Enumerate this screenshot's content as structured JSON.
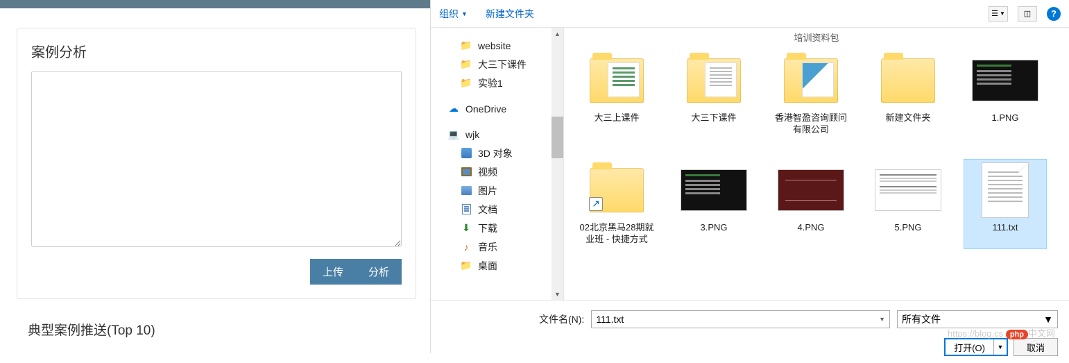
{
  "web": {
    "card_title": "案例分析",
    "upload": "上传",
    "analyze": "分析",
    "top10": "典型案例推送(Top 10)"
  },
  "dialog": {
    "toolbar": {
      "organize": "组织",
      "new_folder": "新建文件夹"
    },
    "tree": {
      "website": "website",
      "dasanxia": "大三下课件",
      "shiyan1": "实验1",
      "onedrive": "OneDrive",
      "pc": "wjk",
      "obj3d": "3D 对象",
      "video": "视频",
      "pics": "图片",
      "docs": "文档",
      "downloads": "下载",
      "music": "音乐",
      "desktop": "桌面"
    },
    "category": "培训资料包",
    "files": {
      "f0": "大三上课件",
      "f1": "大三下课件",
      "f2": "香港智盈咨询顾问有限公司",
      "f3": "新建文件夹",
      "f4": "1.PNG",
      "f5": "02北京黑马28期就业班 - 快捷方式",
      "f6": "3.PNG",
      "f7": "4.PNG",
      "f8": "5.PNG",
      "f9": "111.txt"
    },
    "footer": {
      "filename_label": "文件名(N):",
      "filename_value": "111.txt",
      "filetype": "所有文件",
      "open": "打开(O)",
      "cancel": "取消"
    },
    "watermark": "中文网"
  }
}
